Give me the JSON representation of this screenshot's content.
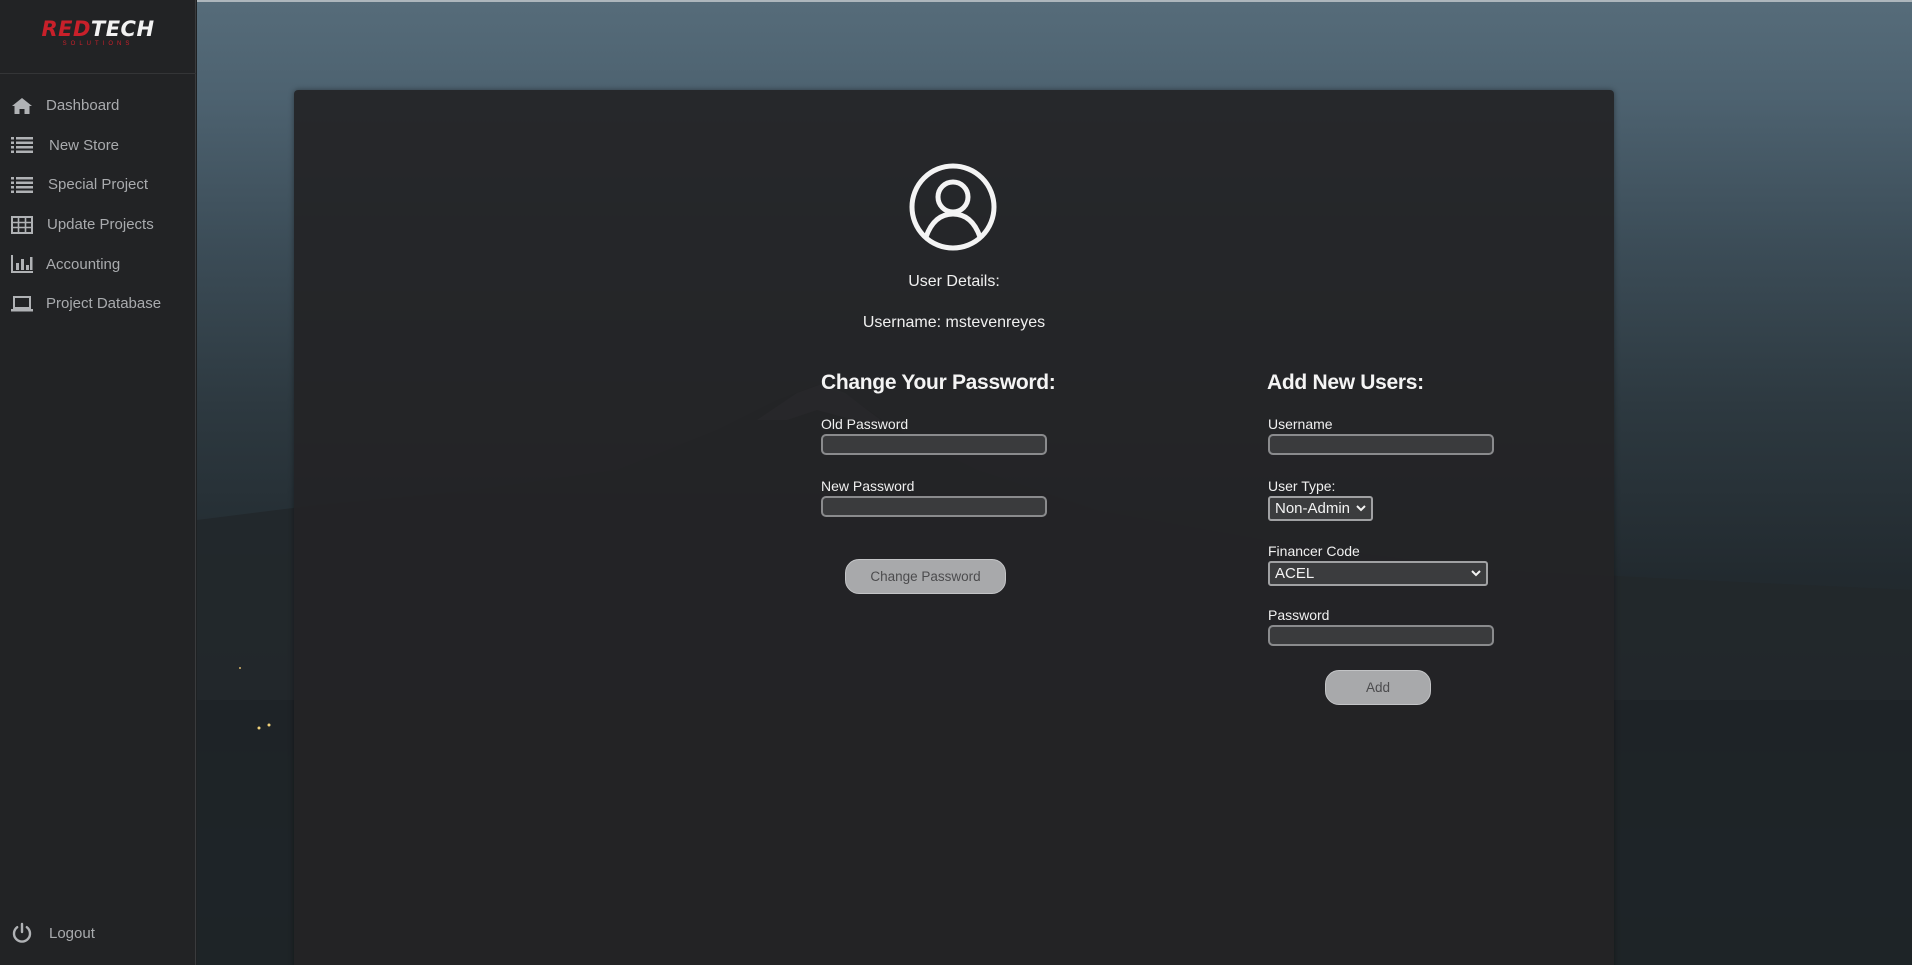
{
  "logo": {
    "part_red": "RED",
    "part_white": "TECH",
    "sub": "SOLUTIONS"
  },
  "sidebar": {
    "items": [
      {
        "label": "Dashboard",
        "icon": "home-icon"
      },
      {
        "label": "New Store",
        "icon": "list-icon"
      },
      {
        "label": "Special Project",
        "icon": "list-icon"
      },
      {
        "label": "Update Projects",
        "icon": "table-icon"
      },
      {
        "label": "Accounting",
        "icon": "bar-chart-icon"
      },
      {
        "label": "Project Database",
        "icon": "laptop-icon"
      }
    ],
    "logout": {
      "label": "Logout",
      "icon": "power-icon"
    }
  },
  "user_details": {
    "title": "User Details:",
    "username_line": "Username: mstevenreyes"
  },
  "change_password": {
    "title": "Change Your Password:",
    "old_label": "Old Password",
    "old_value": "",
    "new_label": "New Password",
    "new_value": "",
    "button": "Change Password"
  },
  "add_users": {
    "title": "Add New Users:",
    "username_label": "Username",
    "username_value": "",
    "user_type_label": "User Type:",
    "user_type_value": "Non-Admin",
    "financer_label": "Financer Code",
    "financer_value": "ACEL",
    "password_label": "Password",
    "password_value": "",
    "button": "Add"
  },
  "colors": {
    "brand_red": "#c8202a",
    "panel": "#242426",
    "sidebar": "#222325",
    "button": "#a8a9ab"
  }
}
